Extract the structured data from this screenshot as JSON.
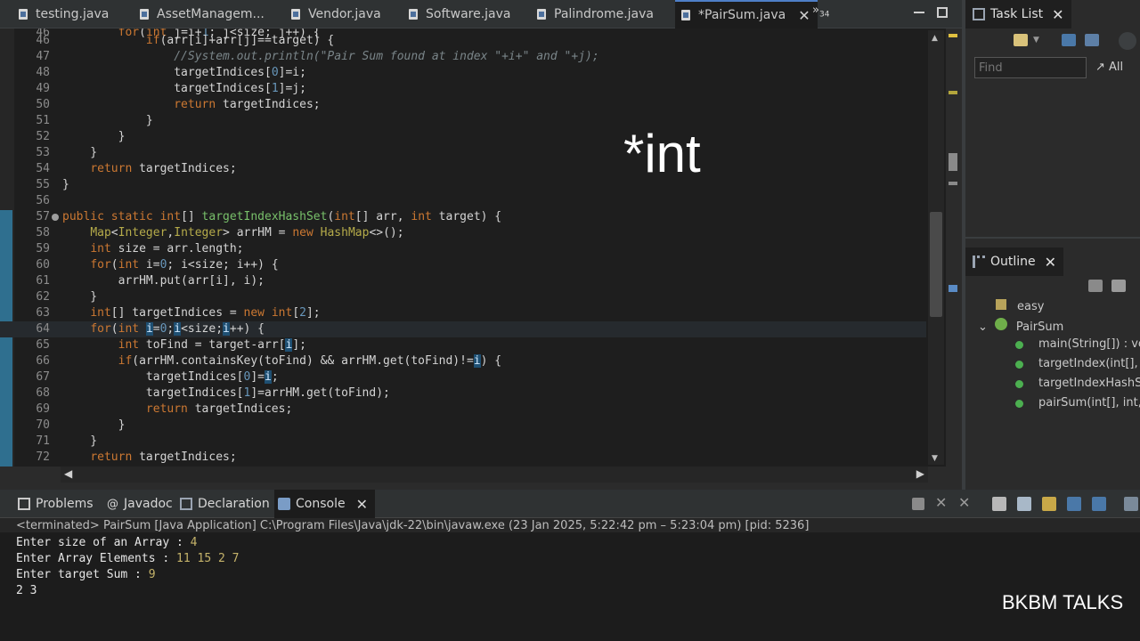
{
  "editor_tabs": [
    {
      "label": "testing.java"
    },
    {
      "label": "AssetManagem..."
    },
    {
      "label": "Vendor.java"
    },
    {
      "label": "Software.java"
    },
    {
      "label": "Palindrome.java"
    },
    {
      "label": "*PairSum.java",
      "active": true
    }
  ],
  "overflow": {
    "label": "»",
    "count": "34"
  },
  "code_lines": {
    "l46": "46",
    "l47": "47",
    "l48": "48",
    "l49": "49",
    "l50": "50",
    "l51": "51",
    "l52": "52",
    "l53": "53",
    "l54": "54",
    "l55": "55",
    "l56": "56",
    "l57": "57",
    "l58": "58",
    "l59": "59",
    "l60": "60",
    "l61": "61",
    "l62": "62",
    "l63": "63",
    "l64": "64",
    "l65": "65",
    "l66": "66",
    "l67": "67",
    "l68": "68",
    "l69": "69",
    "l70": "70",
    "l71": "71",
    "l72": "72"
  },
  "overlay_text": "*int",
  "task_list": {
    "title": "Task List",
    "find_placeholder": "Find",
    "all_label": "All"
  },
  "outline": {
    "title": "Outline",
    "items": [
      {
        "label": "easy"
      },
      {
        "label": "PairSum"
      },
      {
        "label": "main(String[]) : vc"
      },
      {
        "label": "targetIndex(int[], i"
      },
      {
        "label": "targetIndexHashS"
      },
      {
        "label": "pairSum(int[], int,"
      }
    ]
  },
  "bottom_tabs": [
    {
      "label": "Problems"
    },
    {
      "label": "Javadoc"
    },
    {
      "label": "Declaration"
    },
    {
      "label": "Console",
      "active": true
    }
  ],
  "console": {
    "terminated": "<terminated> PairSum [Java Application] C:\\Program Files\\Java\\jdk-22\\bin\\javaw.exe  (23 Jan 2025, 5:22:42 pm – 5:23:04 pm) [pid: 5236]",
    "lines": [
      {
        "prompt": "Enter size of an Array : ",
        "input": "4"
      },
      {
        "prompt": "Enter Array Elements : ",
        "input": "11 15 2 7"
      },
      {
        "prompt": "Enter target Sum : ",
        "input": "9"
      },
      {
        "prompt": "2 3",
        "input": ""
      }
    ]
  },
  "watermark": "BKBM TALKS",
  "colors": {
    "keyword": "#cc7832",
    "type": "#b5ab4a",
    "method": "#78c06a",
    "number": "#6897bb",
    "accent": "#4e7fc7"
  }
}
